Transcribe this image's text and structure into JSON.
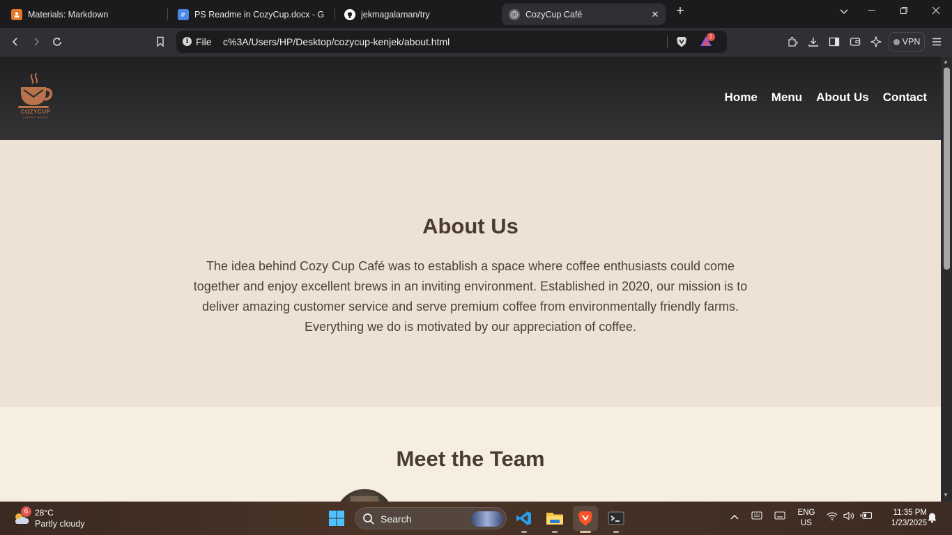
{
  "browser": {
    "tabs": [
      {
        "title": "Materials: Markdown",
        "active": false
      },
      {
        "title": "PS Readme in CozyCup.docx - Goog",
        "active": false
      },
      {
        "title": "jekmagalaman/try",
        "active": false
      },
      {
        "title": "CozyCup Café",
        "active": true
      }
    ],
    "address": {
      "scheme": "File",
      "url": "c%3A/Users/HP/Desktop/cozycup-kenjek/about.html"
    },
    "notification_count": "1",
    "vpn_label": "VPN"
  },
  "site": {
    "logo": {
      "word": "COZYCUP",
      "sub": "COFFEE HOUSE"
    },
    "nav": [
      "Home",
      "Menu",
      "About Us",
      "Contact"
    ],
    "about": {
      "heading": "About Us",
      "body": "The idea behind Cozy Cup Café was to establish a space where coffee enthusiasts could come together and enjoy excellent brews in an inviting environment. Established in 2020, our mission is to deliver amazing customer service and serve premium coffee from environmentally friendly farms. Everything we do is motivated by our appreciation of coffee."
    },
    "team": {
      "heading": "Meet the Team"
    }
  },
  "taskbar": {
    "weather": {
      "temp": "28°C",
      "condition": "Partly cloudy",
      "badge": "6"
    },
    "search_label": "Search",
    "language": {
      "line1": "ENG",
      "line2": "US"
    },
    "clock": {
      "time": "11:35 PM",
      "date": "1/23/2025"
    }
  },
  "colors": {
    "header_bg": "#2a2a2c",
    "about_bg": "#ede2d3",
    "team_bg": "#f6efe0",
    "heading_text": "#4a3b31",
    "logo_accent": "#b8734a"
  }
}
